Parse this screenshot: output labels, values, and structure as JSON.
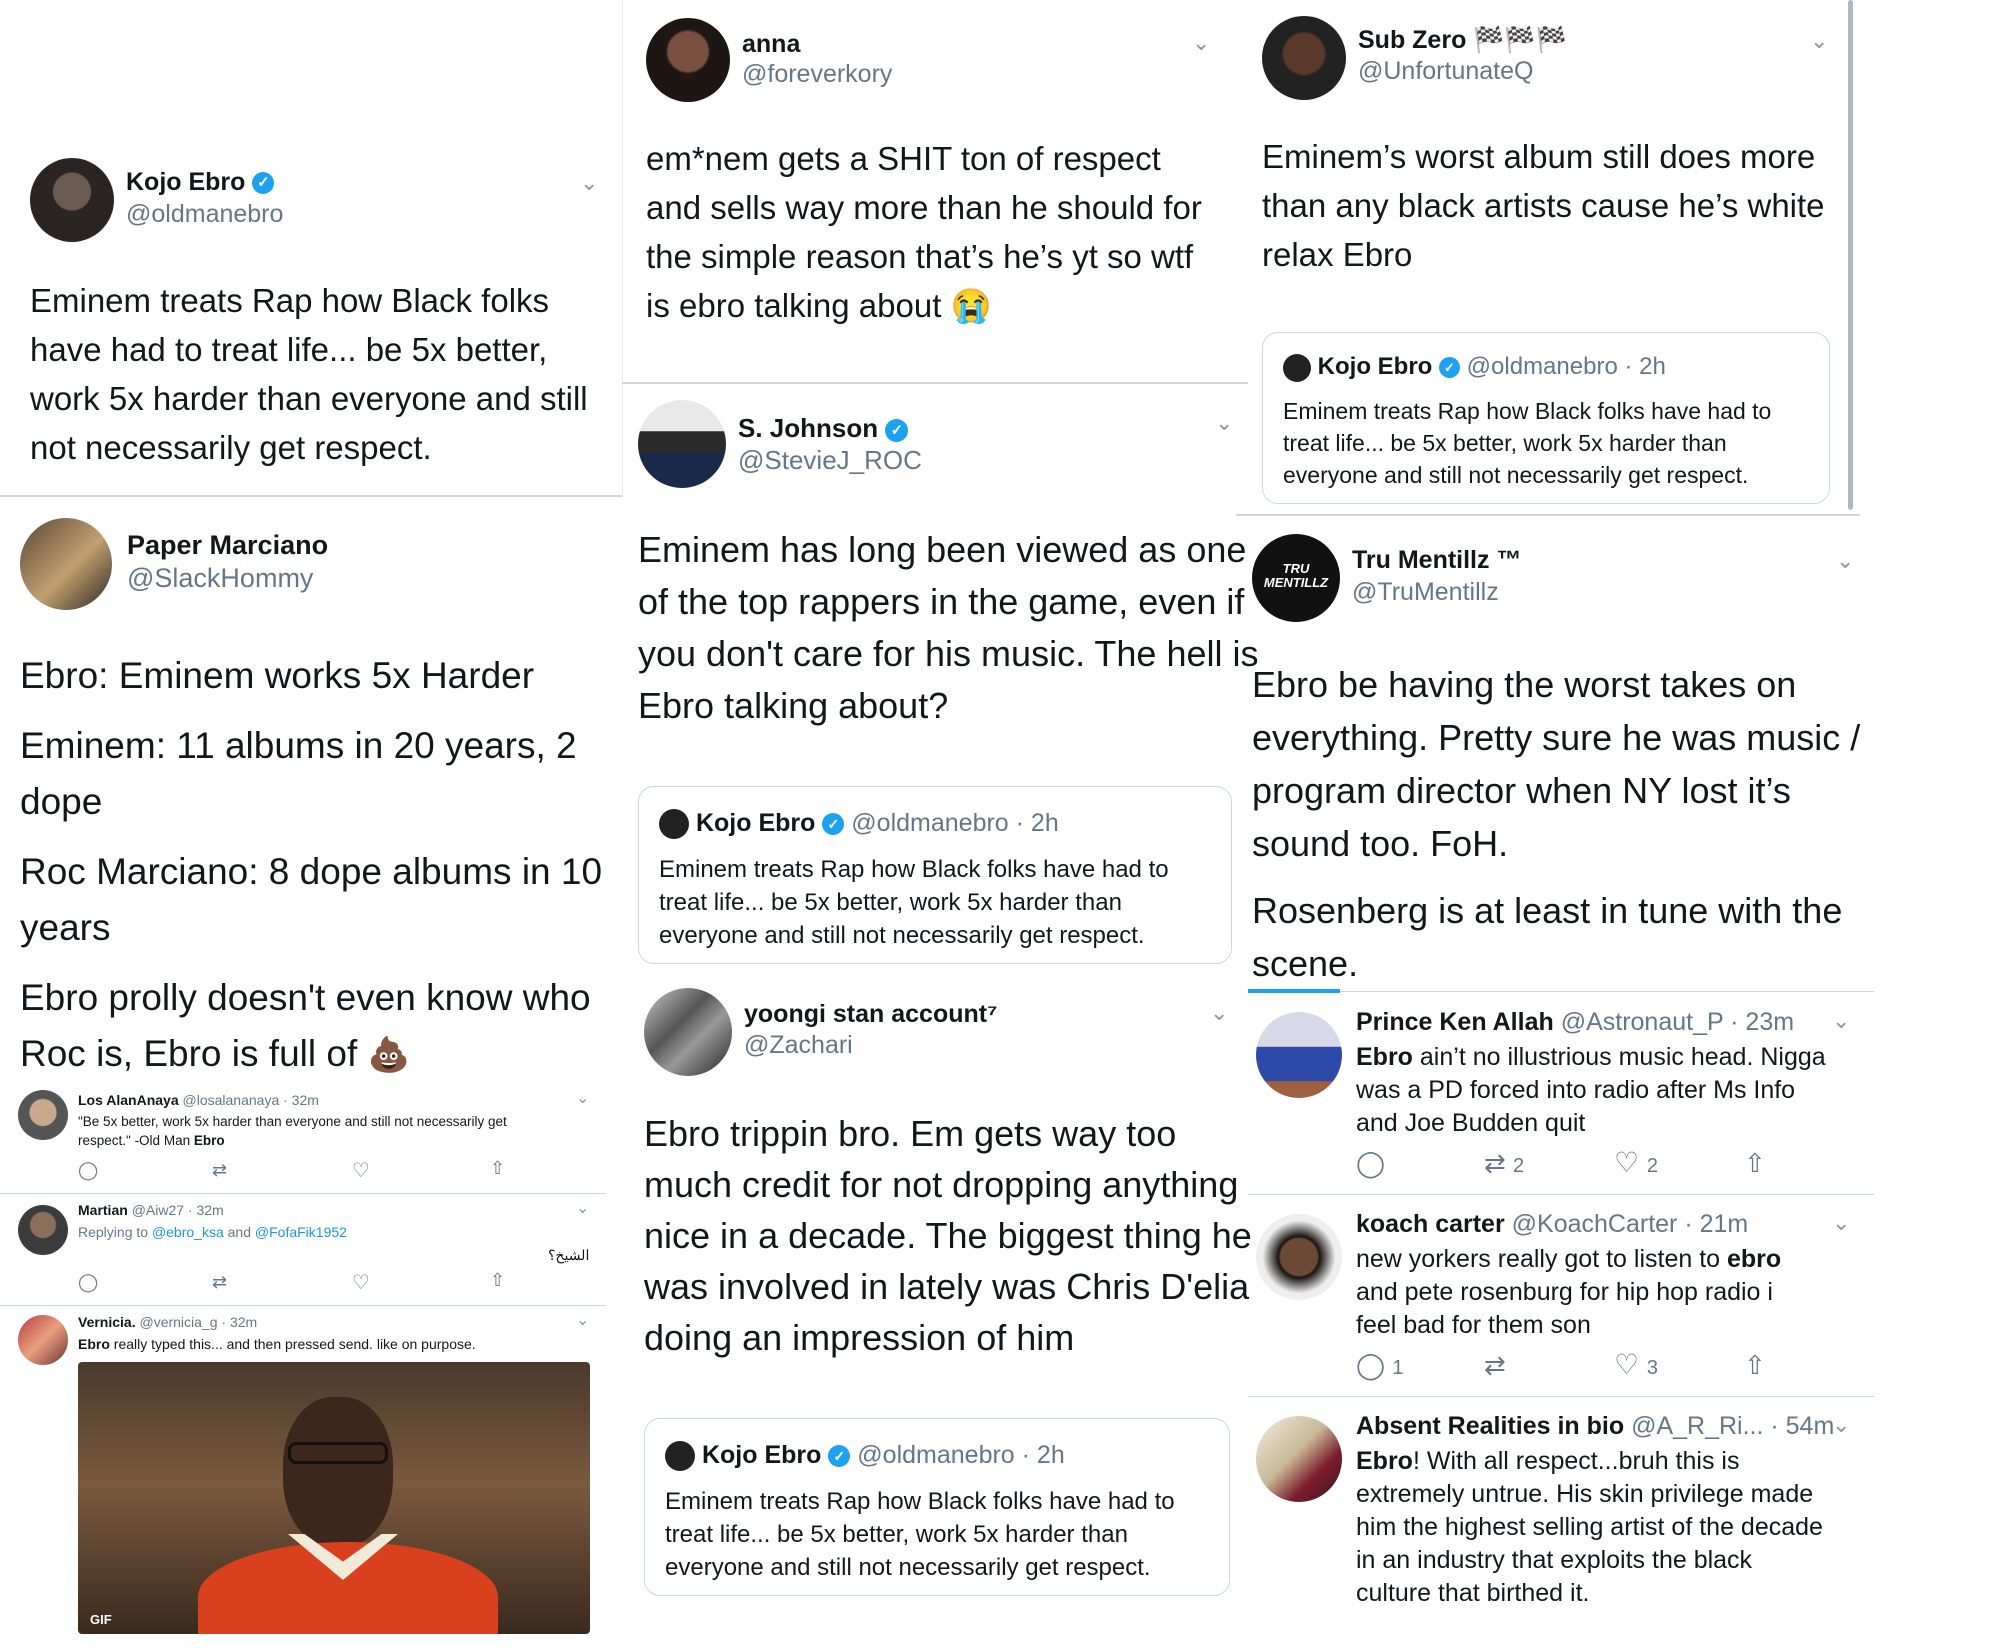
{
  "colors": {
    "brand": "#1da1f2",
    "text": "#14171a",
    "secondary": "#657786",
    "divider": "#ccd6dd"
  },
  "icons": [
    "verified-badge-icon",
    "chevron-down-icon",
    "reply-icon",
    "retweet-icon",
    "like-icon",
    "share-icon",
    "poop-emoji",
    "crying-emoji"
  ],
  "col1": {
    "kojo": {
      "name": "Kojo Ebro",
      "handle": "@oldmanebro",
      "lines": [
        "Eminem treats Rap how Black folks",
        "have had to treat life... be 5x better,",
        "work 5x harder than everyone and still",
        "not necessarily get respect."
      ]
    },
    "paper": {
      "name": "Paper Marciano",
      "handle": "@SlackHommy",
      "p1": "Ebro: Eminem works 5x Harder",
      "p2": [
        "Eminem: 11 albums in 20 years, 2",
        "dope"
      ],
      "p3": [
        "Roc Marciano: 8 dope albums in 10",
        "years"
      ],
      "p4a": "Ebro prolly doesn't even know who",
      "p4b": "Roc is, Ebro is full of"
    },
    "replies": [
      {
        "name": "Los AlanAnaya",
        "meta": "@losalananaya · 32m",
        "text1": "\"Be 5x better, work 5x harder than everyone and still not necessarily get",
        "text2": "respect.\" -Old Man ",
        "text2b": "Ebro"
      },
      {
        "name": "Martian",
        "meta": "@Aiw27 · 32m",
        "replying": "Replying to ",
        "r1": "@ebro_ksa",
        "and": " and ",
        "r2": "@FofaFik1952",
        "arabic": "الشيخ؟"
      },
      {
        "name": "Vernicia.",
        "meta": "@vernicia_g · 32m",
        "textb": "Ebro",
        "text": " really typed this... and then pressed send. like on purpose.",
        "gif_label": "GIF"
      }
    ]
  },
  "col2": {
    "anna": {
      "name": "anna",
      "handle": "@foreverkory",
      "lines": [
        "em*nem gets a SHIT ton of respect",
        "and sells way more than he should for",
        "the simple reason that’s he’s yt so wtf",
        "is ebro talking about"
      ]
    },
    "sjohnson": {
      "name": "S. Johnson",
      "handle": "@StevieJ_ROC",
      "lines": [
        "Eminem has long been viewed as one",
        "of the top rappers in the game, even if",
        "you don't care for his music. The hell is",
        "Ebro talking about?"
      ]
    },
    "yoongi": {
      "name": "yoongi stan account⁷",
      "handle": "@Zachari",
      "lines": [
        "Ebro trippin bro. Em gets way too",
        "much credit for not dropping anything",
        "nice in a decade. The biggest thing he",
        "was involved in lately was Chris D'elia",
        "doing an impression of him"
      ]
    }
  },
  "quote": {
    "name": "Kojo Ebro",
    "meta": "@oldmanebro · 2h",
    "lines": [
      "Eminem treats Rap how Black folks have had to",
      "treat life... be 5x better, work 5x harder than",
      "everyone and still not necessarily get respect."
    ]
  },
  "col3": {
    "subzero": {
      "name": "Sub Zero 🏁🏁🏁",
      "handle": "@UnfortunateQ",
      "lines": [
        "Eminem’s worst album  still does more",
        "than any black artists cause he’s white",
        "relax Ebro"
      ]
    },
    "tru": {
      "name": "Tru Mentillz ™",
      "handle": "@TruMentillz",
      "logo": "TRU MENTILLZ",
      "lines": [
        "Ebro be having the worst takes on",
        "everything. Pretty sure he was music /",
        "program director when NY lost it’s",
        "sound too. FoH."
      ],
      "lines2": [
        "Rosenberg is at least in tune with the",
        "scene."
      ]
    },
    "replies": [
      {
        "name": "Prince Ken Allah",
        "meta": "@Astronaut_P · 23m",
        "l1b": "Ebro",
        "l1": " ain’t no illustrious music head. Nigga",
        "l2": "was a PD forced into radio after Ms Info",
        "l3": "and Joe Budden quit",
        "retweets": "2",
        "likes": "2"
      },
      {
        "name": "koach carter",
        "meta": "@KoachCarter · 21m",
        "l1": "new yorkers really  got to listen to ",
        "l1b": "ebro",
        "l2": "and pete rosenburg for hip hop radio   i",
        "l3": "feel bad for them son",
        "replies": "1",
        "likes": "3"
      },
      {
        "name": "Absent Realities in bio",
        "meta": "@A_R_Ri... · 54m",
        "l1b": "Ebro",
        "l1": "! With all respect...bruh this is",
        "l2": "extremely untrue. His skin privilege made",
        "l3": "him the highest selling artist of the decade",
        "l4": "in an industry that exploits the black",
        "l5": "culture that birthed it."
      }
    ]
  }
}
